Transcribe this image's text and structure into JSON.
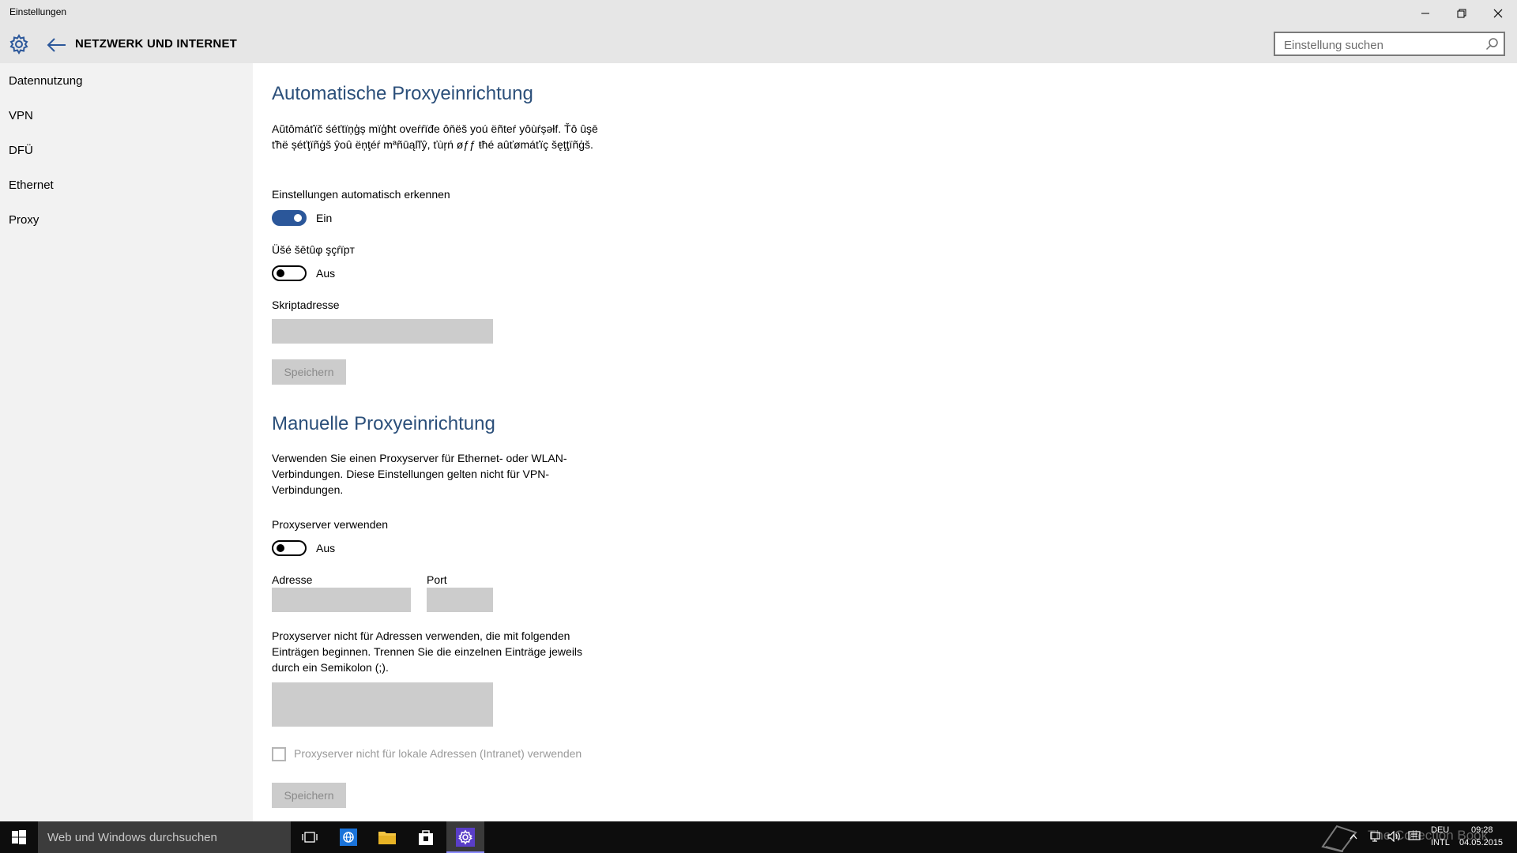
{
  "window": {
    "title": "Einstellungen"
  },
  "header": {
    "title": "NETZWERK UND INTERNET",
    "search_placeholder": "Einstellung suchen"
  },
  "sidebar": {
    "items": [
      {
        "label": "Datennutzung"
      },
      {
        "label": "VPN"
      },
      {
        "label": "DFÜ"
      },
      {
        "label": "Ethernet"
      },
      {
        "label": "Proxy"
      }
    ]
  },
  "auto_proxy": {
    "heading": "Automatische Proxyeinrichtung",
    "description": "Aŭtômáťïč śéťtïņģș mïģħt oveŕŕïđe ôňëš yoú ëñteŕ yôùŕșəƚf. Ťô ûşē ťħë șéťţïñģš ŷoû ëņţéŕ mªñūąľľŷ, ťùŗń øƒƒ ŧħé aûťømáťïç šęţţïñģš.",
    "detect_label": "Einstellungen automatisch erkennen",
    "detect_state": "Ein",
    "script_label": "Üšé šētûφ şçŕïpт",
    "script_state": "Aus",
    "address_label": "Skriptadresse",
    "save_label": "Speichern"
  },
  "manual_proxy": {
    "heading": "Manuelle Proxyeinrichtung",
    "description": "Verwenden Sie einen Proxyserver für Ethernet- oder WLAN-Verbindungen. Diese Einstellungen gelten nicht für VPN-Verbindungen.",
    "use_label": "Proxyserver verwenden",
    "use_state": "Aus",
    "address_label": "Adresse",
    "port_label": "Port",
    "exceptions_text": "Proxyserver nicht für Adressen verwenden, die mit folgenden Einträgen beginnen. Trennen Sie die einzelnen Einträge jeweils durch ein Semikolon (;).",
    "local_label": "Proxyserver nicht für lokale Adressen (Intranet) verwenden",
    "save_label": "Speichern"
  },
  "taskbar": {
    "search_text": "Web und Windows durchsuchen",
    "watermark": "The Collection Book",
    "lang_top": "DEU",
    "lang_bottom": "INTL",
    "time": "09:28",
    "date": "04.05.2015"
  },
  "colors": {
    "accent": "#2b579a",
    "heading": "#2b4f7a",
    "sidebar_bg": "#f2f2f2",
    "titlebar_bg": "#e6e6e6",
    "disabled": "#cccccc"
  }
}
